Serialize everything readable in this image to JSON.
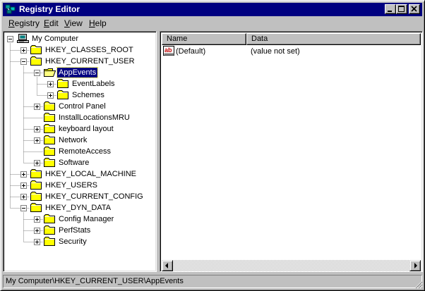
{
  "window": {
    "title": "Registry Editor",
    "accent": "#000080",
    "icon": "registry-editor-icon"
  },
  "caption_buttons": [
    "minimize-icon",
    "maximize-icon",
    "close-icon"
  ],
  "menu": {
    "items": [
      {
        "first": "R",
        "rest": "egistry"
      },
      {
        "first": "E",
        "rest": "dit"
      },
      {
        "first": "V",
        "rest": "iew"
      },
      {
        "first": "H",
        "rest": "elp"
      }
    ]
  },
  "tree": {
    "nodes": [
      {
        "label": "My Computer",
        "level": 0,
        "toggle": "minus",
        "icon": "computer-icon"
      },
      {
        "label": "HKEY_CLASSES_ROOT",
        "level": 1,
        "toggle": "plus",
        "icon": "folder-icon"
      },
      {
        "label": "HKEY_CURRENT_USER",
        "level": 1,
        "toggle": "minus",
        "icon": "folder-icon"
      },
      {
        "label": "AppEvents",
        "level": 2,
        "toggle": "minus",
        "icon": "open-folder-icon",
        "selected": true
      },
      {
        "label": "EventLabels",
        "level": 3,
        "toggle": "plus",
        "icon": "folder-icon"
      },
      {
        "label": "Schemes",
        "level": 3,
        "toggle": "plus",
        "icon": "folder-icon"
      },
      {
        "label": "Control Panel",
        "level": 2,
        "toggle": "plus",
        "icon": "folder-icon"
      },
      {
        "label": "InstallLocationsMRU",
        "level": 2,
        "toggle": "none",
        "icon": "folder-icon"
      },
      {
        "label": "keyboard layout",
        "level": 2,
        "toggle": "plus",
        "icon": "folder-icon"
      },
      {
        "label": "Network",
        "level": 2,
        "toggle": "plus",
        "icon": "folder-icon"
      },
      {
        "label": "RemoteAccess",
        "level": 2,
        "toggle": "none",
        "icon": "folder-icon"
      },
      {
        "label": "Software",
        "level": 2,
        "toggle": "plus",
        "icon": "folder-icon"
      },
      {
        "label": "HKEY_LOCAL_MACHINE",
        "level": 1,
        "toggle": "plus",
        "icon": "folder-icon"
      },
      {
        "label": "HKEY_USERS",
        "level": 1,
        "toggle": "plus",
        "icon": "folder-icon"
      },
      {
        "label": "HKEY_CURRENT_CONFIG",
        "level": 1,
        "toggle": "plus",
        "icon": "folder-icon"
      },
      {
        "label": "HKEY_DYN_DATA",
        "level": 1,
        "toggle": "minus",
        "icon": "folder-icon"
      },
      {
        "label": "Config Manager",
        "level": 2,
        "toggle": "plus",
        "icon": "folder-icon"
      },
      {
        "label": "PerfStats",
        "level": 2,
        "toggle": "plus",
        "icon": "folder-icon"
      },
      {
        "label": "Security",
        "level": 2,
        "toggle": "plus",
        "icon": "folder-icon"
      }
    ]
  },
  "list": {
    "columns": [
      "Name",
      "Data"
    ],
    "rows": [
      {
        "name": "(Default)",
        "data": "(value not set)",
        "icon": "string-value-icon"
      }
    ]
  },
  "status": {
    "path": "My Computer\\HKEY_CURRENT_USER\\AppEvents"
  }
}
